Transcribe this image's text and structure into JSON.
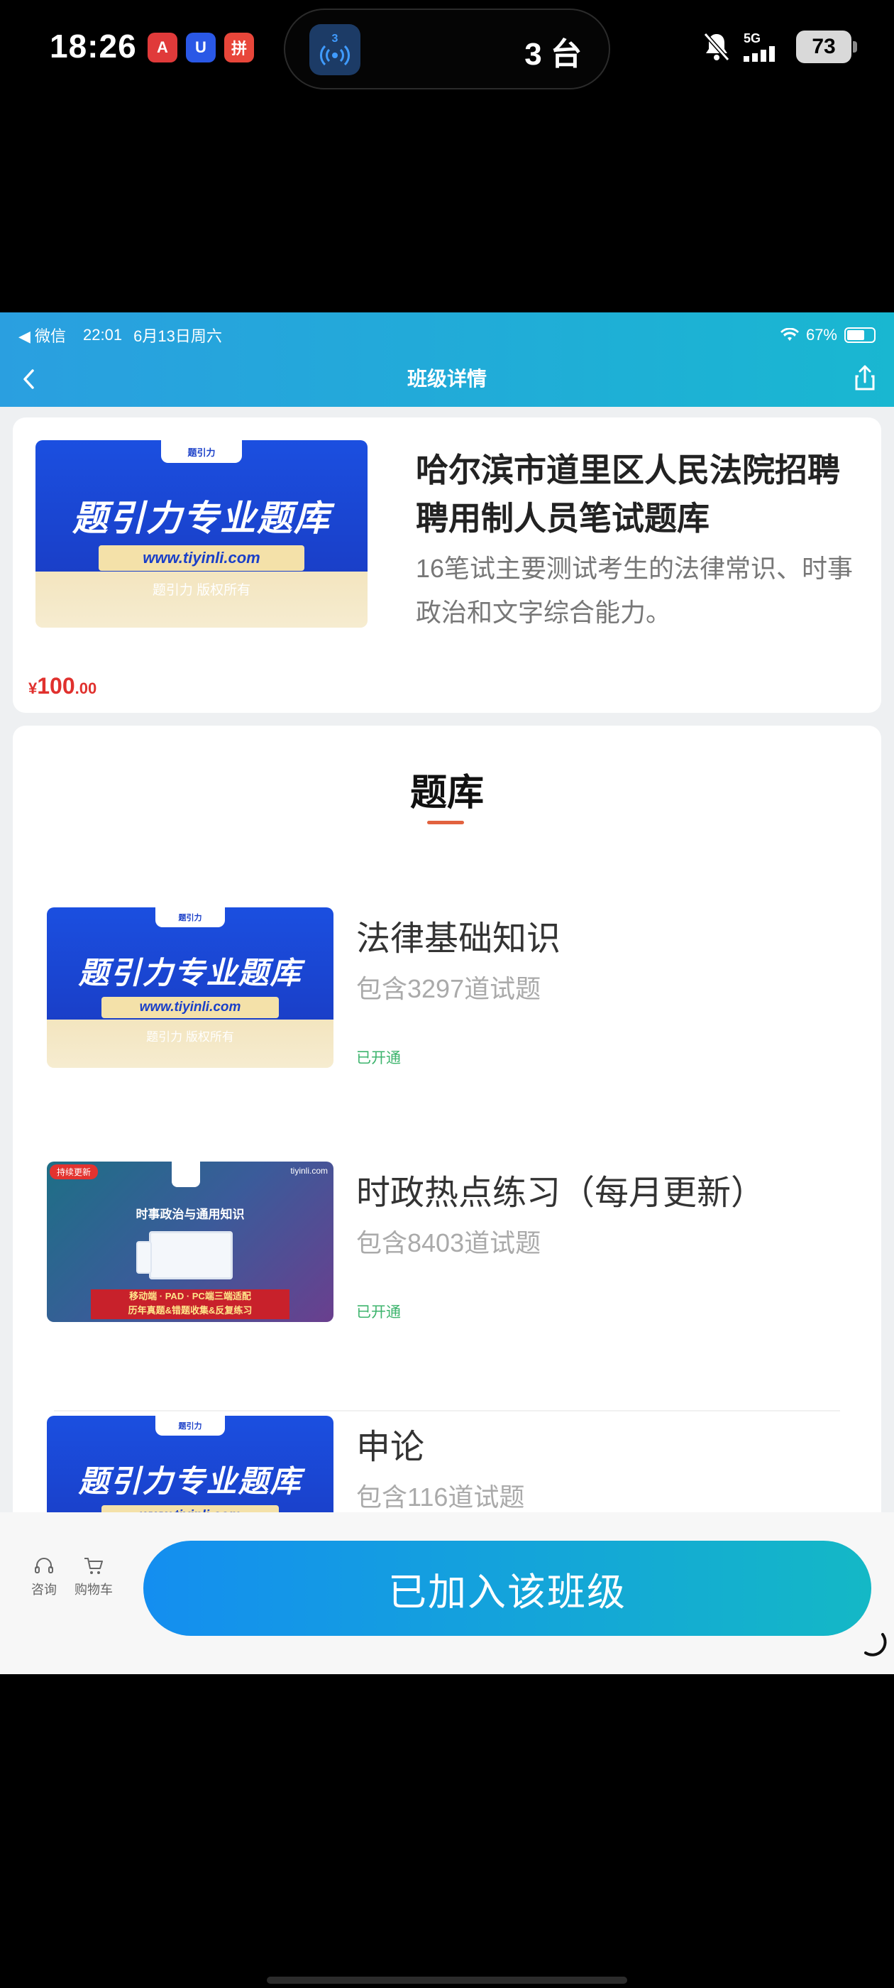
{
  "phone_status": {
    "time": "18:26",
    "app_icons": [
      "A",
      "U",
      "拼"
    ],
    "island": {
      "badge": "3",
      "label": "3 台"
    },
    "network": "5G",
    "battery": "73"
  },
  "ios_status": {
    "back_app": "◀ 微信",
    "time": "22:01",
    "date": "6月13日周六",
    "battery": "67%"
  },
  "nav": {
    "title": "班级详情"
  },
  "course": {
    "title": "哈尔滨市道里区人民法院招聘聘用制人员笔试题库",
    "description": "16笔试主要测试考生的法律常识、时事政治和文字综合能力。",
    "price_symbol": "¥",
    "price_int": "100",
    "price_dec": ".00",
    "cover": {
      "badge": "题引力",
      "title": "题引力专业题库",
      "url": "www.tiyinli.com",
      "subtitle": "题引力 版权所有"
    }
  },
  "bank": {
    "title": "题库",
    "items": [
      {
        "title": "法律基础知识",
        "count": "包含3297道试题",
        "status": "已开通",
        "cover": "blue"
      },
      {
        "title": "时政热点练习（每月更新）",
        "count": "包含8403道试题",
        "status": "已开通",
        "cover": "purple"
      },
      {
        "title": "申论",
        "count": "包含116道试题",
        "status": "",
        "cover": "blue"
      }
    ],
    "purple_cover": {
      "tag": "持续更新",
      "brand": "tiyinli.com",
      "title": "时事政治与通用知识",
      "banner_line1": "移动端 · PAD · PC端三端适配",
      "banner_line2": "历年真题&错题收集&反复练习"
    }
  },
  "bottom": {
    "consult": "咨询",
    "cart": "购物车",
    "join_label": "已加入该班级"
  }
}
